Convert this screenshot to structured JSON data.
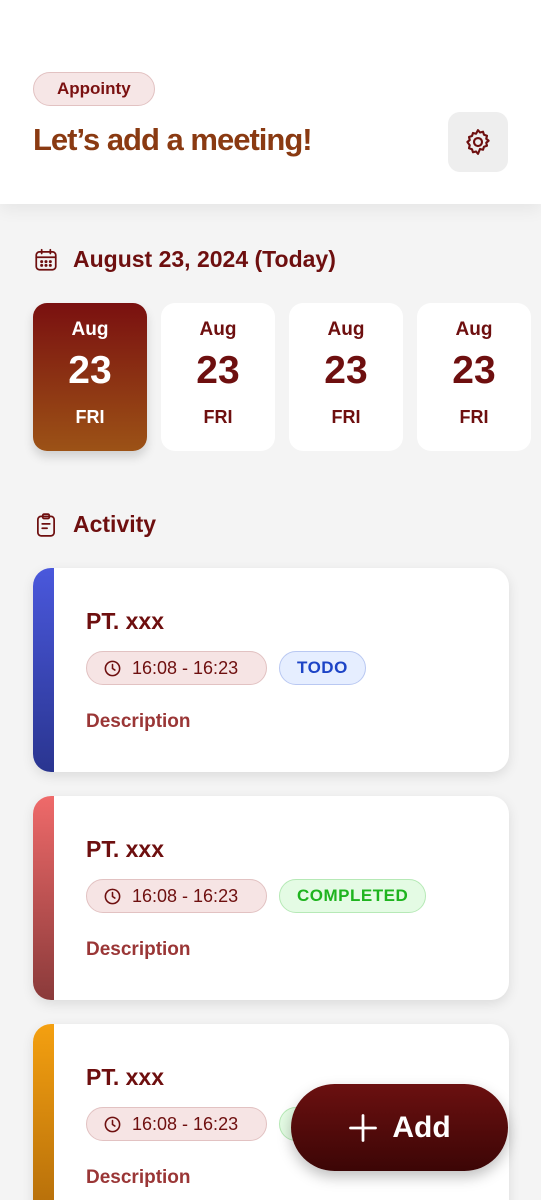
{
  "header": {
    "brand": "Appointy",
    "title": "Let’s add a meeting!",
    "settings_icon": "gear-icon"
  },
  "date_section": {
    "icon": "calendar-icon",
    "heading": "August 23, 2024 (Today)",
    "days": [
      {
        "month": "Aug",
        "day": "23",
        "weekday": "FRI",
        "selected": true
      },
      {
        "month": "Aug",
        "day": "23",
        "weekday": "FRI",
        "selected": false
      },
      {
        "month": "Aug",
        "day": "23",
        "weekday": "FRI",
        "selected": false
      },
      {
        "month": "Aug",
        "day": "23",
        "weekday": "FRI",
        "selected": false
      }
    ]
  },
  "activity_section": {
    "icon": "clipboard-icon",
    "heading": "Activity",
    "items": [
      {
        "title": "PT. xxx",
        "time": "16:08 - 16:23",
        "status": "TODO",
        "description": "Description",
        "accent": "#3a44b8",
        "status_bg": "#e6eeff",
        "status_border": "#b9c8f2",
        "status_color": "#1d44c6"
      },
      {
        "title": "PT. xxx",
        "time": "16:08 - 16:23",
        "status": "COMPLETED",
        "description": "Description",
        "accent": "#d85a5a",
        "status_bg": "#e4fbe4",
        "status_border": "#b6e9b6",
        "status_color": "#1fb41f"
      },
      {
        "title": "PT. xxx",
        "time": "16:08 - 16:23",
        "status": "",
        "description": "Description",
        "accent": "#e89a10",
        "status_bg": "#e4fbe4",
        "status_border": "#b6e9b6",
        "status_color": "#1fb41f"
      }
    ]
  },
  "fab": {
    "label": "Add",
    "icon": "plus-icon"
  },
  "colors": {
    "brand_dark": "#6e0f0f",
    "title_brown": "#8a3a12",
    "background": "#f4f4f4"
  }
}
